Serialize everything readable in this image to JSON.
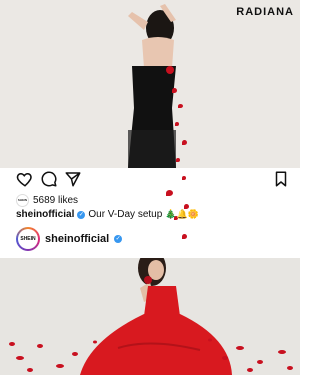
{
  "brand": {
    "text": "RADIANA"
  },
  "post": {
    "likes": "5689 likes",
    "username": "sheinofficial",
    "caption": "Our V-Day setup",
    "caption_emojis": "🎄🔔🌼"
  },
  "profile": {
    "avatar_text": "SHEIN",
    "username": "sheinofficial"
  },
  "mini_avatar_text": "SHEIN",
  "icons": [
    "heart-icon",
    "comment-icon",
    "share-icon",
    "bookmark-icon",
    "verified-badge-icon"
  ],
  "colors": {
    "accent": "#3797f0",
    "rose": "#c8101f",
    "dress": "#d8191f"
  }
}
